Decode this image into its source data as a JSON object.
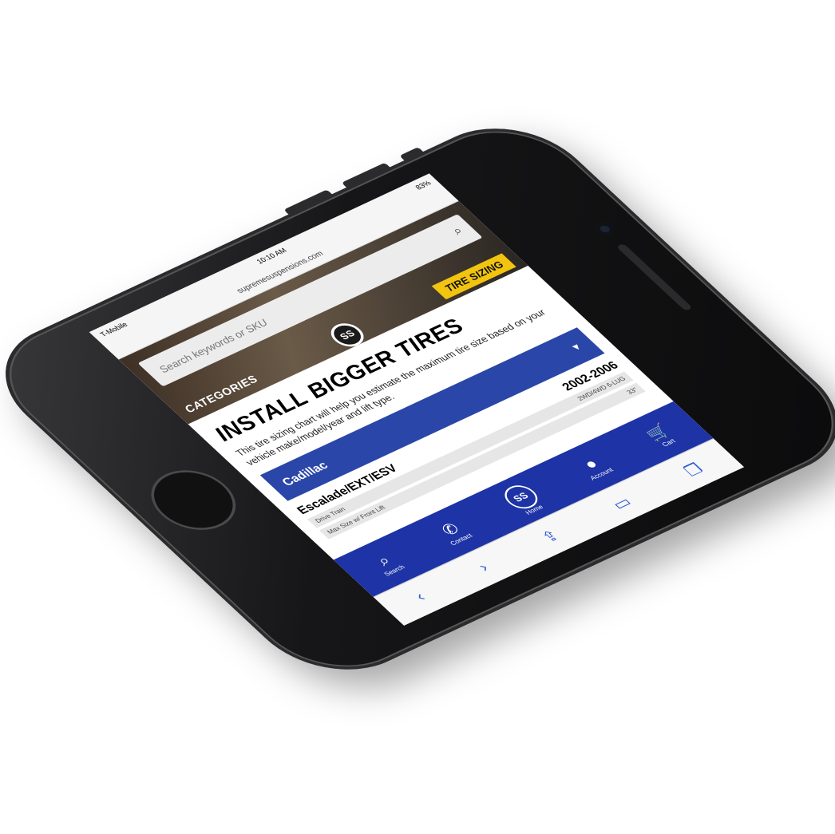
{
  "status": {
    "carrier": "T-Mobile",
    "time": "10:10 AM",
    "battery": "83%"
  },
  "address": {
    "url": "supremesuspensions.com"
  },
  "search": {
    "placeholder": "Search keywords or SKU"
  },
  "hero": {
    "categories_label": "CATEGORIES",
    "logo_text": "SS",
    "tire_badge": "TIRE SIZING"
  },
  "content": {
    "title": "INSTALL BIGGER TIRES",
    "description": "This tire sizing chart will help you estimate the maximum tire size based on your vehicle make/model/year and lift type.",
    "make": "Cadillac",
    "model": "Escalade/EXT/ESV",
    "years": "2002-2006",
    "spec_label_drive": "Drive Train",
    "spec_value_drive": "2WD/4WD 6-LUG",
    "spec_label_max": "Max Size w/ Front Lift",
    "spec_value_max": "33\""
  },
  "tabbar": {
    "items": [
      {
        "label": "Search",
        "icon": "search-icon"
      },
      {
        "label": "Contact",
        "icon": "phone-icon"
      },
      {
        "label": "Home",
        "icon": "home-logo-icon"
      },
      {
        "label": "Account",
        "icon": "user-icon"
      },
      {
        "label": "Cart",
        "icon": "cart-icon"
      }
    ]
  },
  "colors": {
    "brand_blue": "#2a46a8",
    "tab_blue": "#1d33a6",
    "accent_yellow": "#f2c40f"
  }
}
